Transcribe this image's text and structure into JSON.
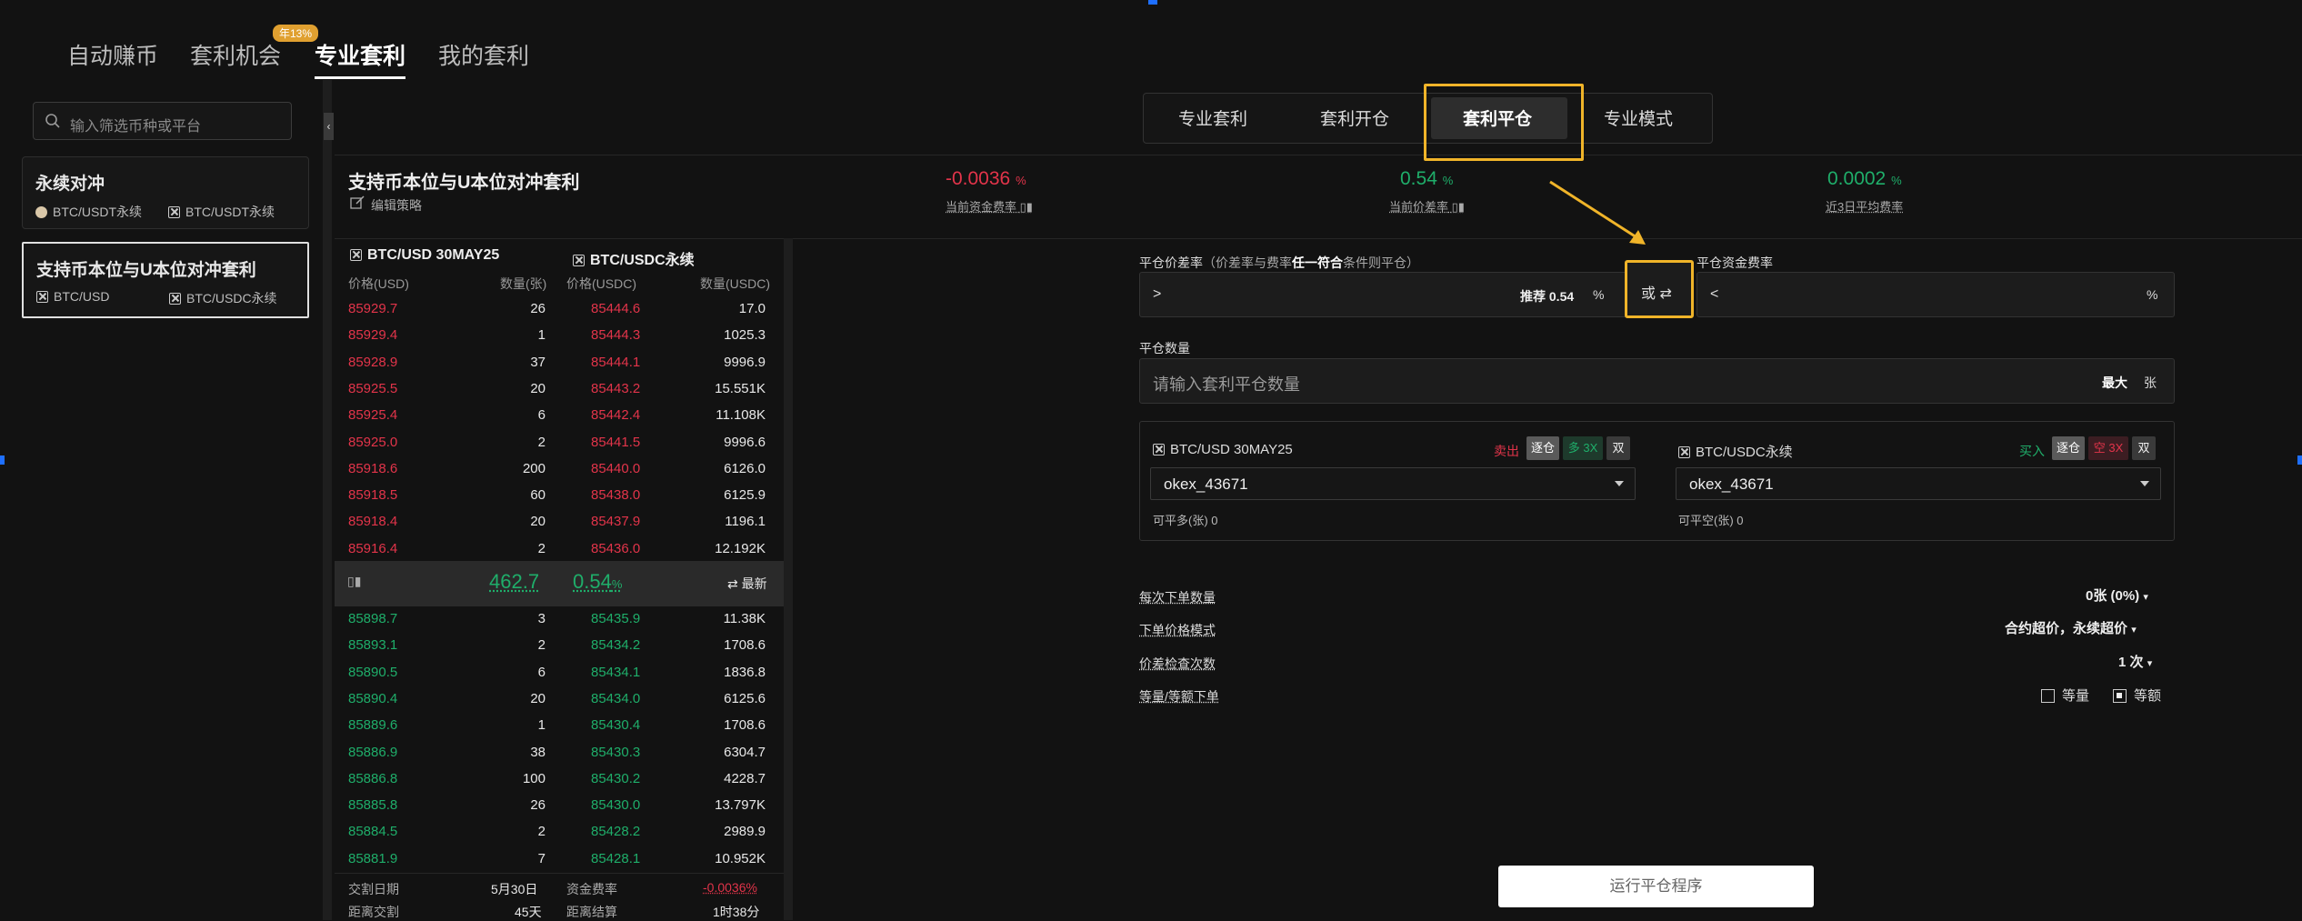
{
  "top_tabs": [
    {
      "label": "自动赚币"
    },
    {
      "label": "套利机会",
      "badge": "年13%"
    },
    {
      "label": "专业套利",
      "active": true
    },
    {
      "label": "我的套利"
    }
  ],
  "sidebar": {
    "search_placeholder": "输入筛选币种或平台",
    "cards": [
      {
        "title": "永续对冲",
        "legs": [
          "BTC/USDT永续",
          "BTC/USDT永续"
        ]
      },
      {
        "title": "支持币本位与U本位对冲套利",
        "legs": [
          "BTC/USD",
          "BTC/USDC永续"
        ],
        "selected": true
      }
    ]
  },
  "strategy": {
    "title": "支持币本位与U本位对冲套利",
    "edit_label": "编辑策略",
    "stats": [
      {
        "value": "-0.0036",
        "unit": "%",
        "label": "当前资金费率",
        "color": "#e2344a"
      },
      {
        "value": "0.54",
        "unit": "%",
        "label": "当前价差率",
        "color": "#1fae6a"
      },
      {
        "value": "0.0002",
        "unit": "%",
        "label": "近3日平均费率",
        "color": "#1fae6a"
      }
    ]
  },
  "orderbook": {
    "left_symbol": "BTC/USD 30MAY25",
    "right_symbol": "BTC/USDC永续",
    "columns": [
      "价格(USD)",
      "数量(张)",
      "价格(USDC)",
      "数量(USDC)"
    ],
    "asks": [
      [
        "85929.7",
        "26",
        "85444.6",
        "17.0"
      ],
      [
        "85929.4",
        "1",
        "85444.3",
        "1025.3"
      ],
      [
        "85928.9",
        "37",
        "85444.1",
        "9996.9"
      ],
      [
        "85925.5",
        "20",
        "85443.2",
        "15.551K"
      ],
      [
        "85925.4",
        "6",
        "85442.4",
        "11.108K"
      ],
      [
        "85925.0",
        "2",
        "85441.5",
        "9996.6"
      ],
      [
        "85918.6",
        "200",
        "85440.0",
        "6126.0"
      ],
      [
        "85918.5",
        "60",
        "85438.0",
        "6125.9"
      ],
      [
        "85918.4",
        "20",
        "85437.9",
        "1196.1"
      ],
      [
        "85916.4",
        "2",
        "85436.0",
        "12.192K"
      ]
    ],
    "mid": {
      "spread": "462.7",
      "spread_pct": "0.54",
      "pct_unit": "%",
      "latest_label": "最新"
    },
    "bids": [
      [
        "85898.7",
        "3",
        "85435.9",
        "11.38K"
      ],
      [
        "85893.1",
        "2",
        "85434.2",
        "1708.6"
      ],
      [
        "85890.5",
        "6",
        "85434.1",
        "1836.8"
      ],
      [
        "85890.4",
        "20",
        "85434.0",
        "6125.6"
      ],
      [
        "85889.6",
        "1",
        "85430.4",
        "1708.6"
      ],
      [
        "85886.9",
        "38",
        "85430.3",
        "6304.7"
      ],
      [
        "85886.8",
        "100",
        "85430.2",
        "4228.7"
      ],
      [
        "85885.8",
        "26",
        "85430.0",
        "13.797K"
      ],
      [
        "85884.5",
        "2",
        "85428.2",
        "2989.9"
      ],
      [
        "85881.9",
        "7",
        "85428.1",
        "10.952K"
      ]
    ],
    "footer": [
      {
        "l1": "交割日期",
        "v1": "5月30日",
        "l2": "资金费率",
        "v2": "-0.0036%"
      },
      {
        "l1": "距离交割",
        "v1": "45天",
        "l2": "距离结算",
        "v2": "1时38分"
      }
    ]
  },
  "mode_tabs": [
    "专业套利",
    "套利开仓",
    "套利平仓",
    "专业模式"
  ],
  "form": {
    "spread_label": "平仓价差率",
    "spread_hint_pre": "（价差率与费率",
    "spread_hint_bold": "任一符合",
    "spread_hint_post": "条件则平仓）",
    "spread_op": ">",
    "spread_recommend": "推荐 0.54",
    "spread_unit": "%",
    "or_label": "或",
    "funding_label": "平仓资金费率",
    "funding_op": "<",
    "funding_unit": "%",
    "qty_label": "平仓数量",
    "qty_placeholder": "请输入套利平仓数量",
    "qty_max": "最大",
    "qty_unit": "张",
    "legs": [
      {
        "symbol": "BTC/USD 30MAY25",
        "side": "卖出",
        "side_color": "#e2344a",
        "chips": [
          "逐仓",
          "多 3X",
          "双"
        ],
        "account": "okex_43671",
        "avail": "可平多(张) 0"
      },
      {
        "symbol": "BTC/USDC永续",
        "side": "买入",
        "side_color": "#1fae6a",
        "chips": [
          "逐仓",
          "空 3X",
          "双"
        ],
        "account": "okex_43671",
        "avail": "可平空(张) 0"
      }
    ],
    "options": [
      {
        "label": "每次下单数量",
        "value": "0张 (0%)"
      },
      {
        "label": "下单价格模式",
        "value": "合约超价，永续超价"
      },
      {
        "label": "价差检查次数",
        "value": "1 次"
      },
      {
        "label": "等量/等额下单",
        "choice1": "等量",
        "choice2": "等额"
      }
    ],
    "run_button": "运行平仓程序"
  },
  "colors": {
    "accent_highlight": "#f0b429",
    "red": "#e2344a",
    "green": "#1fae6a"
  }
}
